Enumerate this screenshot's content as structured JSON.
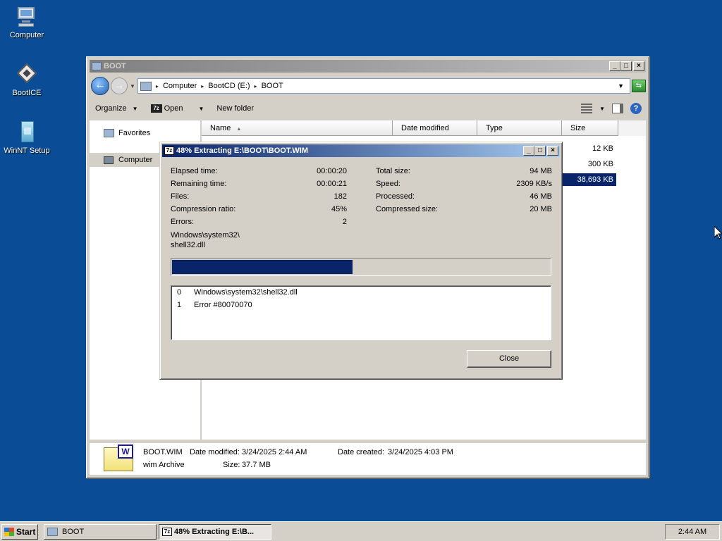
{
  "desktop": {
    "icons": [
      {
        "label": "Computer",
        "icon": "computer-icon"
      },
      {
        "label": "BootICE",
        "icon": "bootice-icon"
      },
      {
        "label": "WinNT Setup",
        "icon": "winnt-setup-icon"
      }
    ]
  },
  "explorer": {
    "title": "BOOT",
    "breadcrumbs": [
      "Computer",
      "BootCD (E:)",
      "BOOT"
    ],
    "toolbar": {
      "organize": "Organize",
      "open": "Open",
      "new_folder": "New folder"
    },
    "nav": {
      "favorites": "Favorites",
      "computer": "Computer"
    },
    "columns": {
      "name": "Name",
      "date_modified": "Date modified",
      "type": "Type",
      "size": "Size"
    },
    "sizes": [
      "12 KB",
      "300 KB",
      "38,693 KB"
    ],
    "details": {
      "filename": "BOOT.WIM",
      "filetype": "wim Archive",
      "date_modified_label": "Date modified:",
      "date_modified": "3/24/2025 2:44 AM",
      "date_created_label": "Date created:",
      "date_created": "3/24/2025 4:03 PM",
      "size_label": "Size:",
      "size": "37.7 MB"
    }
  },
  "dialog": {
    "title": "48% Extracting E:\\BOOT\\BOOT.WIM",
    "left": [
      {
        "label": "Elapsed time:",
        "value": "00:00:20"
      },
      {
        "label": "Remaining time:",
        "value": "00:00:21"
      },
      {
        "label": "Files:",
        "value": "182"
      },
      {
        "label": "Compression ratio:",
        "value": "45%"
      },
      {
        "label": "Errors:",
        "value": "2"
      }
    ],
    "right": [
      {
        "label": "Total size:",
        "value": "94 MB"
      },
      {
        "label": "Speed:",
        "value": "2309 KB/s"
      },
      {
        "label": "Processed:",
        "value": "46 MB"
      },
      {
        "label": "Compressed size:",
        "value": "20 MB"
      }
    ],
    "current_path_line1": "Windows\\system32\\",
    "current_path_line2": "shell32.dll",
    "progress_percent": 48,
    "log": [
      {
        "num": "0",
        "text": "Windows\\system32\\shell32.dll"
      },
      {
        "num": "1",
        "text": "Error #80070070"
      }
    ],
    "close_label": "Close"
  },
  "taskbar": {
    "start": "Start",
    "tasks": [
      "BOOT",
      "48% Extracting E:\\B..."
    ],
    "clock": "2:44 AM"
  }
}
